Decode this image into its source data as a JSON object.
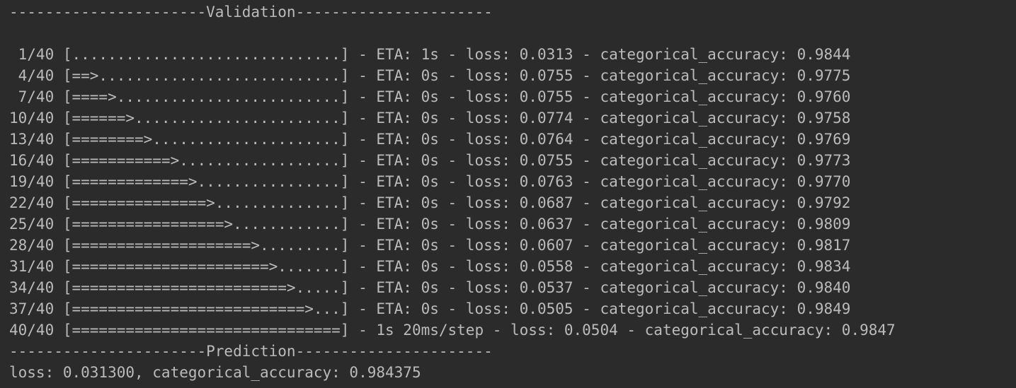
{
  "console": {
    "validation_header": "----------------------Validation----------------------",
    "progress_lines": [
      " 1/40 [..............................] - ETA: 1s - loss: 0.0313 - categorical_accuracy: 0.9844",
      " 4/40 [==>...........................] - ETA: 0s - loss: 0.0755 - categorical_accuracy: 0.9775",
      " 7/40 [====>.........................] - ETA: 0s - loss: 0.0755 - categorical_accuracy: 0.9760",
      "10/40 [======>.......................] - ETA: 0s - loss: 0.0774 - categorical_accuracy: 0.9758",
      "13/40 [========>.....................] - ETA: 0s - loss: 0.0764 - categorical_accuracy: 0.9769",
      "16/40 [===========>..................] - ETA: 0s - loss: 0.0755 - categorical_accuracy: 0.9773",
      "19/40 [=============>................] - ETA: 0s - loss: 0.0763 - categorical_accuracy: 0.9770",
      "22/40 [===============>..............] - ETA: 0s - loss: 0.0687 - categorical_accuracy: 0.9792",
      "25/40 [=================>............] - ETA: 0s - loss: 0.0637 - categorical_accuracy: 0.9809",
      "28/40 [====================>.........] - ETA: 0s - loss: 0.0607 - categorical_accuracy: 0.9817",
      "31/40 [======================>.......] - ETA: 0s - loss: 0.0558 - categorical_accuracy: 0.9834",
      "34/40 [========================>.....] - ETA: 0s - loss: 0.0537 - categorical_accuracy: 0.9840",
      "37/40 [==========================>...] - ETA: 0s - loss: 0.0505 - categorical_accuracy: 0.9849",
      "40/40 [==============================] - 1s 20ms/step - loss: 0.0504 - categorical_accuracy: 0.9847"
    ],
    "prediction_header": "----------------------Prediction----------------------",
    "prediction_result": "loss: 0.031300, categorical_accuracy: 0.984375"
  }
}
